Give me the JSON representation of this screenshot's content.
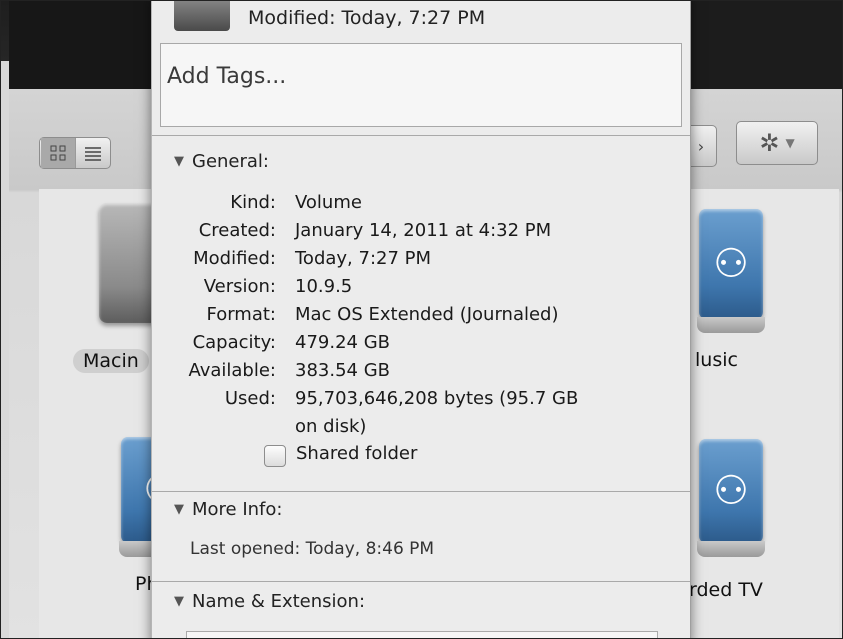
{
  "panel": {
    "header_modified": "Modified: Today, 7:27 PM",
    "tags_placeholder": "Add Tags...",
    "general": {
      "title": "General:",
      "rows": [
        {
          "key": "Kind:",
          "value": "Volume"
        },
        {
          "key": "Created:",
          "value": "January 14, 2011 at 4:32 PM"
        },
        {
          "key": "Modified:",
          "value": "Today, 7:27 PM"
        },
        {
          "key": "Version:",
          "value": "10.9.5"
        },
        {
          "key": "Format:",
          "value": "Mac OS Extended (Journaled)"
        },
        {
          "key": "Capacity:",
          "value": "479.24 GB"
        },
        {
          "key": "Available:",
          "value": "383.54 GB"
        },
        {
          "key": "Used:",
          "value": "95,703,646,208 bytes (95.7 GB"
        }
      ],
      "used_cont": "on disk)",
      "shared_folder_label": "Shared folder",
      "shared_folder_checked": false
    },
    "more_info": {
      "title": "More Info:",
      "last_opened": "Last opened: Today, 8:46 PM"
    },
    "name_extension": {
      "title": "Name & Extension:"
    }
  },
  "finder": {
    "drive_labels": {
      "macintosh": "Macin",
      "music": "lusic",
      "photos": "Ph",
      "recorded_tv": "rded TV"
    },
    "view_icons": [
      "grid-view-icon",
      "list-view-icon"
    ],
    "action_icon": "gear-icon"
  }
}
